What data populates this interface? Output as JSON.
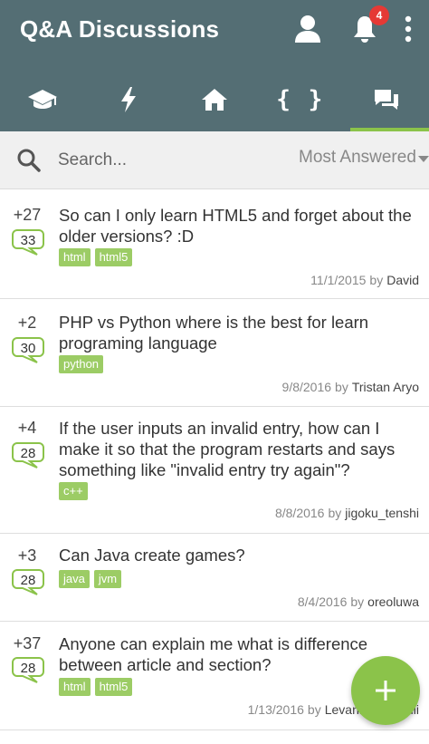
{
  "app": {
    "title": "Q&A Discussions",
    "notification_count": "4"
  },
  "tabs": [
    {
      "icon": "graduation-cap-icon"
    },
    {
      "icon": "lightning-icon"
    },
    {
      "icon": "home-icon"
    },
    {
      "icon": "code-braces-icon",
      "label": "{ }"
    },
    {
      "icon": "chat-bubbles-icon",
      "active": true
    }
  ],
  "search": {
    "placeholder": "Search...",
    "sort": "Most Answered"
  },
  "questions": [
    {
      "votes": "+27",
      "answers": "33",
      "title": "So can I only learn HTML5 and forget about the older versions? :D",
      "tags": [
        "html",
        "html5"
      ],
      "date": "11/1/2015",
      "by": "by",
      "author": "David"
    },
    {
      "votes": "+2",
      "answers": "30",
      "title": "PHP vs Python where is the best for learn programing language",
      "tags": [
        "python"
      ],
      "date": "9/8/2016",
      "by": "by",
      "author": "Tristan Aryo"
    },
    {
      "votes": "+4",
      "answers": "28",
      "title": "If the user inputs an invalid entry, how can I make it so that the program restarts and says something like \"invalid entry try again\"?",
      "tags": [
        "c++"
      ],
      "date": "8/8/2016",
      "by": "by",
      "author": "jigoku_tenshi"
    },
    {
      "votes": "+3",
      "answers": "28",
      "title": "Can Java create games?",
      "tags": [
        "java",
        "jvm"
      ],
      "date": "8/4/2016",
      "by": "by",
      "author": "oreoluwa"
    },
    {
      "votes": "+37",
      "answers": "28",
      "title": "Anyone can explain me what is difference between article and section?",
      "tags": [
        "html",
        "html5"
      ],
      "date": "1/13/2016",
      "by": "by",
      "author": "Levani Jikiashvili"
    }
  ],
  "colors": {
    "appbar": "#546e74",
    "accent": "#8bc34a",
    "tag": "#9ccc65",
    "badge": "#e53935"
  }
}
